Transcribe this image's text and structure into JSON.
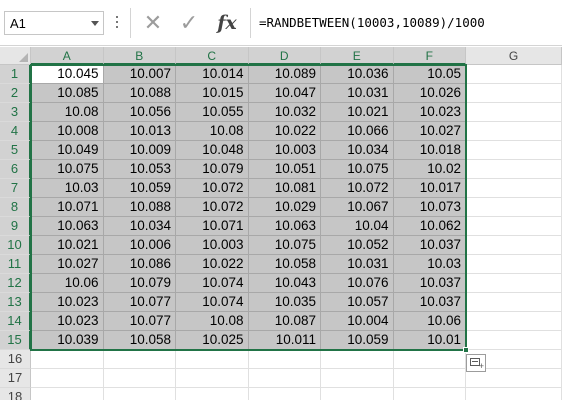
{
  "formula_bar": {
    "name_box": "A1",
    "formula": "=RANDBETWEEN(10003,10089)/1000",
    "cancel_glyph": "✕",
    "enter_glyph": "✓",
    "fx_label": "fx"
  },
  "sheet": {
    "columns": [
      "A",
      "B",
      "C",
      "D",
      "E",
      "F",
      "G"
    ],
    "row_numbers": [
      "1",
      "2",
      "3",
      "4",
      "5",
      "6",
      "7",
      "8",
      "9",
      "10",
      "11",
      "12",
      "13",
      "14",
      "15",
      "16",
      "17",
      "18"
    ],
    "selection": "A1:F15",
    "active_cell": "A1",
    "cells": [
      [
        "10.045",
        "10.007",
        "10.014",
        "10.089",
        "10.036",
        "10.05"
      ],
      [
        "10.085",
        "10.088",
        "10.015",
        "10.047",
        "10.031",
        "10.026"
      ],
      [
        "10.08",
        "10.056",
        "10.055",
        "10.032",
        "10.021",
        "10.023"
      ],
      [
        "10.008",
        "10.013",
        "10.08",
        "10.022",
        "10.066",
        "10.027"
      ],
      [
        "10.049",
        "10.009",
        "10.048",
        "10.003",
        "10.034",
        "10.018"
      ],
      [
        "10.075",
        "10.053",
        "10.079",
        "10.051",
        "10.075",
        "10.02"
      ],
      [
        "10.03",
        "10.059",
        "10.072",
        "10.081",
        "10.072",
        "10.017"
      ],
      [
        "10.071",
        "10.088",
        "10.072",
        "10.029",
        "10.067",
        "10.073"
      ],
      [
        "10.063",
        "10.034",
        "10.071",
        "10.063",
        "10.04",
        "10.062"
      ],
      [
        "10.021",
        "10.006",
        "10.003",
        "10.075",
        "10.052",
        "10.037"
      ],
      [
        "10.027",
        "10.086",
        "10.022",
        "10.058",
        "10.031",
        "10.03"
      ],
      [
        "10.06",
        "10.079",
        "10.074",
        "10.043",
        "10.076",
        "10.037"
      ],
      [
        "10.023",
        "10.077",
        "10.074",
        "10.035",
        "10.057",
        "10.037"
      ],
      [
        "10.023",
        "10.077",
        "10.08",
        "10.087",
        "10.004",
        "10.06"
      ],
      [
        "10.039",
        "10.058",
        "10.025",
        "10.011",
        "10.059",
        "10.01"
      ]
    ]
  },
  "colors": {
    "accent": "#217346",
    "selection_fill": "#c6c6c6",
    "header_fill": "#e6e6e6"
  },
  "icons": {
    "quick_analysis": "quick-analysis-icon"
  }
}
